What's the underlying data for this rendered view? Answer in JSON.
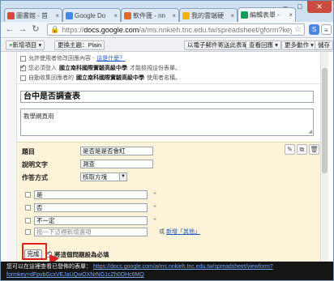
{
  "browser": {
    "tabs": [
      {
        "label": "圖書館 - 首",
        "color": "#d64b3c",
        "active": false
      },
      {
        "label": "Google Do",
        "color": "#4a86e8",
        "active": false
      },
      {
        "label": "軟件匯 - nn",
        "color": "#e06a2a",
        "active": false
      },
      {
        "label": "我的雲端硬",
        "color": "#f1b50a",
        "active": false
      },
      {
        "label": "編輯表單 -",
        "color": "#0f9d58",
        "active": true
      }
    ],
    "tab_close": "×",
    "url_prefix": "https://",
    "url_host": "docs.google.com",
    "url_path": "/a/ms.nnkieh.tnc.edu.tw/spreadsheet/gform?key=0A",
    "win_min": "–",
    "win_max": "□",
    "win_close": "✕"
  },
  "toolbar": {
    "add_item": "新增項目 ▾",
    "theme": "更換主題：Plain",
    "email_link": "以電子郵件寄送此表單",
    "view_responses": "查看回應 ▾",
    "more_actions": "更多動作 ▾",
    "save": "儲存"
  },
  "settings": {
    "row1_text": "允許使用者修改回應內容 - ",
    "row1_link": "這是什麼？",
    "row2_prefix": "您必須登入",
    "row2_bold": "國立南科國際實驗高級中學",
    "row2_suffix": "才能檢視這份表單。",
    "row3_prefix": "自動收集回應者的",
    "row3_bold": "國立南科國際實驗高級中學",
    "row3_suffix": "使用者名稱。"
  },
  "form": {
    "title": "台中是否調查表",
    "description": "教學網頁用"
  },
  "question": {
    "title_label": "題目",
    "title_value": "是否是是否會紅",
    "help_label": "說明文字",
    "help_value": "測查",
    "type_label": "作答方式",
    "type_value": "核取方塊",
    "options": [
      "是",
      "否",
      "不一定"
    ],
    "add_option_placeholder": "按一下這裡新增選項",
    "or_text": "或",
    "add_other_link": "新增「其他」",
    "done_button": "完成",
    "required_label": "將這個問題設為必填"
  },
  "notice": {
    "text": "您可以在這裡查看已發佈的表單：",
    "link": "https://docs.google.com/a/ms.nnkieh.tnc.edu.tw/spreadsheet/viewform?formkey=dFpvbGcxVEJaUQwOXNrNG1cZh0OHc6MQ"
  }
}
